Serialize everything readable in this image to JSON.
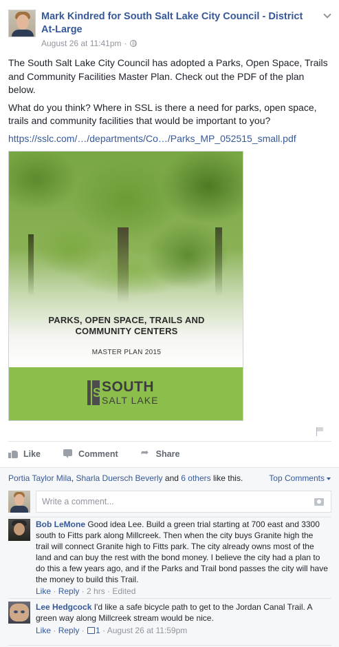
{
  "post": {
    "author": "Mark Kindred for South Salt Lake City Council - District At-Large",
    "timestamp": "August 26 at 11:41pm",
    "separator": "·",
    "paragraph1": "The South Salt Lake City Council has adopted a Parks, Open Space, Trails and Community Facilities Master Plan. Check out the PDF of the plan below.",
    "paragraph2": "What do you think? Where in SSL is there a need for parks, open space, trails and community facilities that would be important to you?",
    "link": "https://sslc.com/…/departments/Co…/Parks_MP_052515_small.pdf"
  },
  "attachment": {
    "title_line1": "PARKS, OPEN SPACE, TRAILS AND",
    "title_line2": "COMMUNITY CENTERS",
    "subtitle": "MASTER PLAN  2015",
    "logo_mark_letter": "S",
    "logo_line1": "SOUTH",
    "logo_line2": "SALT LAKE",
    "band_color": "#8bbe4b"
  },
  "actions": {
    "like": "Like",
    "comment": "Comment",
    "share": "Share"
  },
  "likes": {
    "person1": "Portia Taylor Mila",
    "comma": ",",
    "person2": "Sharla Duersch Beverly",
    "and": " and ",
    "others": "6 others",
    "suffix": " like this.",
    "sort": "Top Comments"
  },
  "write_comment": {
    "placeholder": "Write a comment..."
  },
  "comments": [
    {
      "name": "Bob LeMone",
      "text": " Good idea Lee. Build a green trial starting at 700 east and 3300 south to Fitts park along Millcreek. Then when the city buys Granite high the trail will connect Granite high to Fitts park. The city already owns most of the land and can buy the rest with the bond money. I believe the city had a plan to do this a few years ago, and if the Parks and Trail bond passes the city will have the money to build this Trail.",
      "like": "Like",
      "reply": "Reply",
      "meta": " · 2 hrs · Edited"
    },
    {
      "name": "Lee Hedgcock",
      "text": " I'd like a safe bicycle path to get to the Jordan Canal Trail. A green way along Millcreek stream would be nice.",
      "like": "Like",
      "reply": "Reply",
      "likes_count": "1",
      "meta": " · August 26 at 11:59pm"
    }
  ],
  "colors": {
    "link_blue": "#365899",
    "meta_gray": "#90949c",
    "background": "#ffffff",
    "comments_bg": "#f6f7f9"
  }
}
